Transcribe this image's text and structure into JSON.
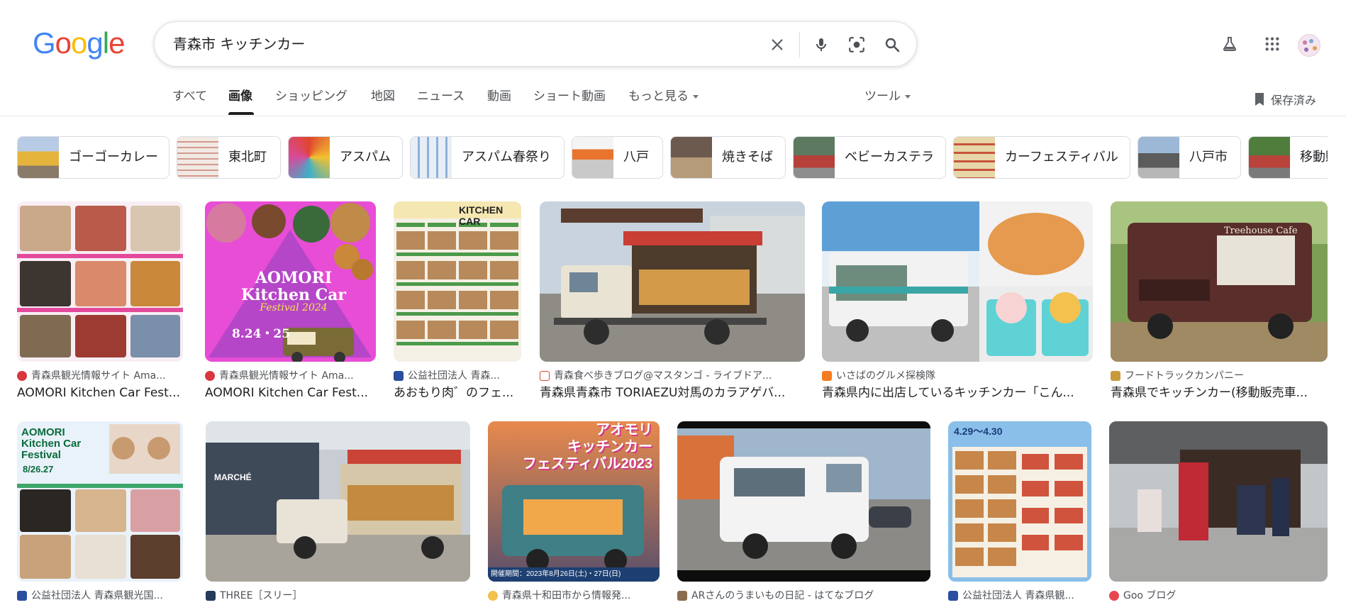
{
  "search": {
    "query": "青森市 キッチンカー"
  },
  "logo": {
    "text": "Google"
  },
  "tabs": [
    "すべて",
    "画像",
    "ショッピング",
    "地図",
    "ニュース",
    "動画",
    "ショート動画",
    "もっと見る"
  ],
  "tools_label": "ツール",
  "saved_label": "保存済み",
  "chips": [
    "ゴーゴーカレー",
    "東北町",
    "アスパム",
    "アスパム春祭り",
    "八戸",
    "焼きそば",
    "ベビーカステラ",
    "カーフェスティバル",
    "八戸市",
    "移動販売"
  ],
  "results_row1": [
    {
      "source": "青森県観光情報サイト Ama...",
      "title": "AOMORI Kitchen Car Fest..."
    },
    {
      "source": "青森県観光情報サイト Ama...",
      "title": "AOMORI Kitchen Car Fest..."
    },
    {
      "source": "公益社団法人 青森...",
      "title": "あおもり肉゛のフェ..."
    },
    {
      "source": "青森食べ歩きブログ@マスタンゴ - ライブドア...",
      "title": "青森県青森市 TORIAEZU対馬のカラアゲバ..."
    },
    {
      "source": "いさばのグルメ探検隊",
      "title": "青森県内に出店しているキッチンカー「こん..."
    },
    {
      "source": "フードトラックカンパニー",
      "title": "青森県でキッチンカー(移動販売車..."
    }
  ],
  "results_row2": [
    {
      "source": "公益社団法人 青森県観光国..."
    },
    {
      "source": "THREE［スリー］"
    },
    {
      "source": "青森県十和田市から情報発..."
    },
    {
      "source": "ARさんのうまいもの日記 - はてなブログ"
    },
    {
      "source": "公益社団法人 青森県観..."
    },
    {
      "source": "Goo ブログ"
    }
  ],
  "image_text": {
    "festival_title": "AOMORI Kitchen Car",
    "festival_sub": "Festival 2024",
    "festival_date": "8.24・25",
    "kitchen_car_header": "KITCHEN CAR",
    "festival2023_title": "AOMORI Kitchen Car Festival",
    "festival2023_date": "8/26.27",
    "poster_line1": "アオモリ",
    "poster_line2": "キッチンカー",
    "poster_line3": "フェスティバル2023",
    "poster_date": "開催期間：2023年8月26日(土)・27日(日)",
    "treehouse": "Treehouse Cafe",
    "marche": "MARCHÉ",
    "menu_date": "4.29〜4.30"
  },
  "colors": {
    "brand_blue": "#4285f4",
    "brand_red": "#ea4335",
    "brand_yellow": "#fbbc05",
    "brand_green": "#34a853"
  }
}
